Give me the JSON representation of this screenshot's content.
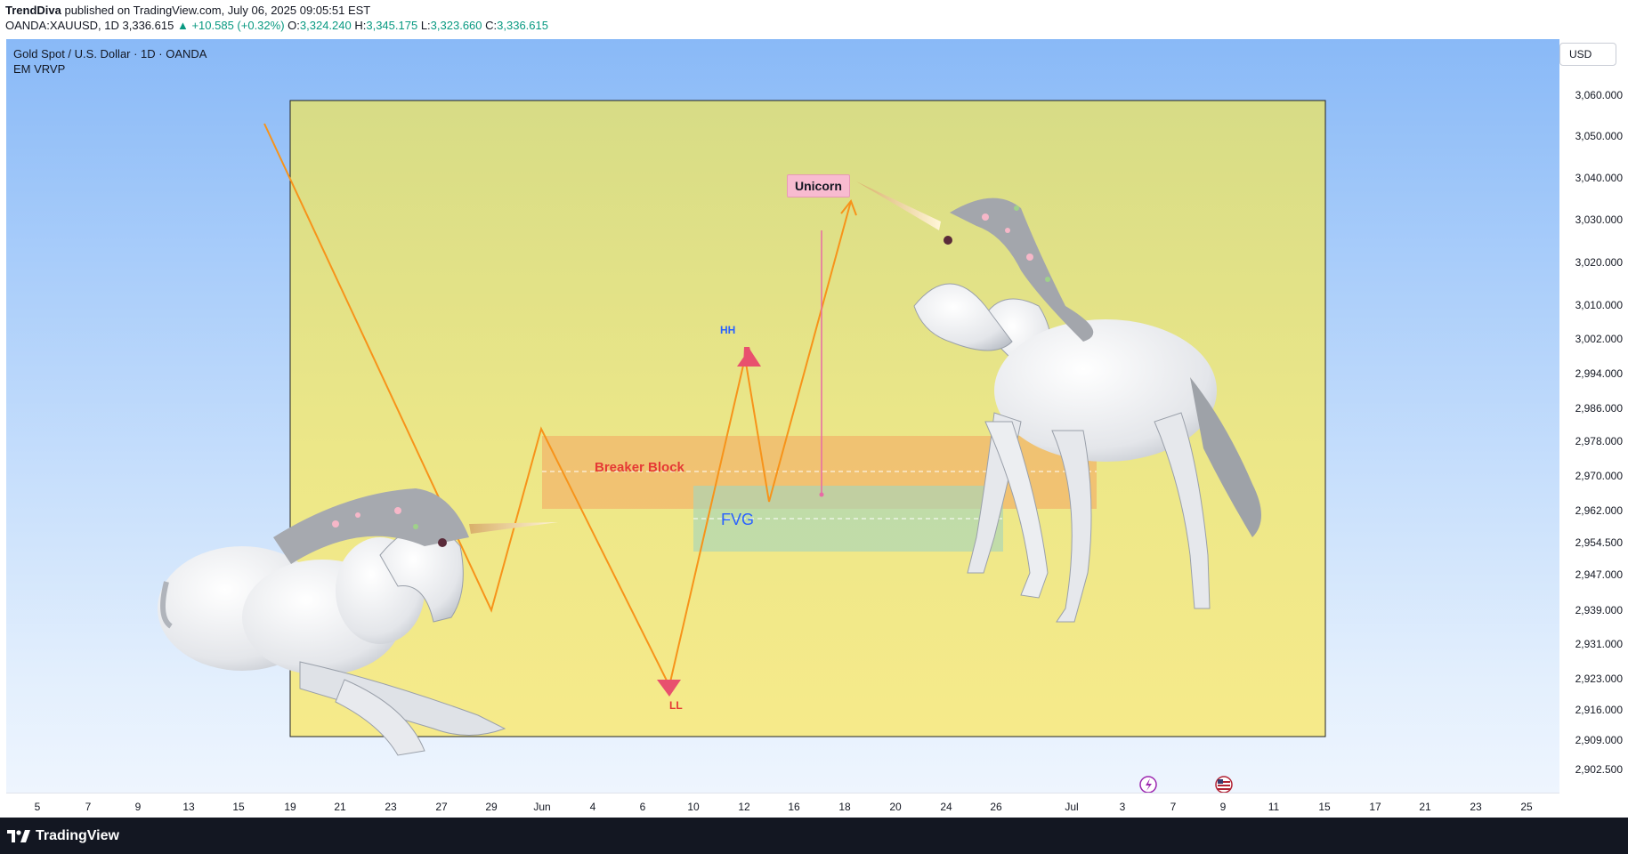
{
  "header": {
    "author": "TrendDiva",
    "published_text": " published on TradingView.com, July 06, 2025 09:05:51 EST",
    "symbol": "OANDA:XAUUSD, 1D",
    "last_price": "3,336.615",
    "change": "▲ +10.585 (+0.32%)",
    "open_label": "O:",
    "open": "3,324.240",
    "high_label": "H:",
    "high": "3,345.175",
    "low_label": "L:",
    "low": "3,323.660",
    "close_label": "C:",
    "close": "3,336.615"
  },
  "legend": {
    "title": "Gold Spot / U.S. Dollar · 1D · OANDA",
    "indicator": "EM VRVP"
  },
  "currency_button": "USD",
  "price_axis": {
    "labels": [
      "3,060.000",
      "3,050.000",
      "3,040.000",
      "3,030.000",
      "3,020.000",
      "3,010.000",
      "3,002.000",
      "2,994.000",
      "2,986.000",
      "2,978.000",
      "2,970.000",
      "2,962.000",
      "2,954.500",
      "2,947.000",
      "2,939.000",
      "2,931.000",
      "2,923.000",
      "2,916.000",
      "2,909.000",
      "2,902.500"
    ]
  },
  "time_axis": {
    "labels": [
      "5",
      "7",
      "9",
      "13",
      "15",
      "19",
      "21",
      "23",
      "27",
      "29",
      "Jun",
      "4",
      "6",
      "10",
      "12",
      "16",
      "18",
      "20",
      "24",
      "26",
      "Jul",
      "3",
      "7",
      "9",
      "11",
      "15",
      "17",
      "21",
      "23",
      "25"
    ]
  },
  "annotations": {
    "unicorn": "Unicorn",
    "hh": "HH",
    "ll": "LL",
    "breaker_block": "Breaker Block",
    "fvg": "FVG"
  },
  "colors": {
    "zigzag": "#f7931a",
    "breaker_fill": "#f4a460",
    "fvg_fill": "#a8d5ba",
    "hh_marker": "#e8506e",
    "unicorn_label_bg": "#f8bbd0",
    "fvg_text": "#2962ff",
    "breaker_text": "#e53935",
    "event_purple": "#9c27b0"
  },
  "footer": {
    "brand": "TradingView"
  }
}
